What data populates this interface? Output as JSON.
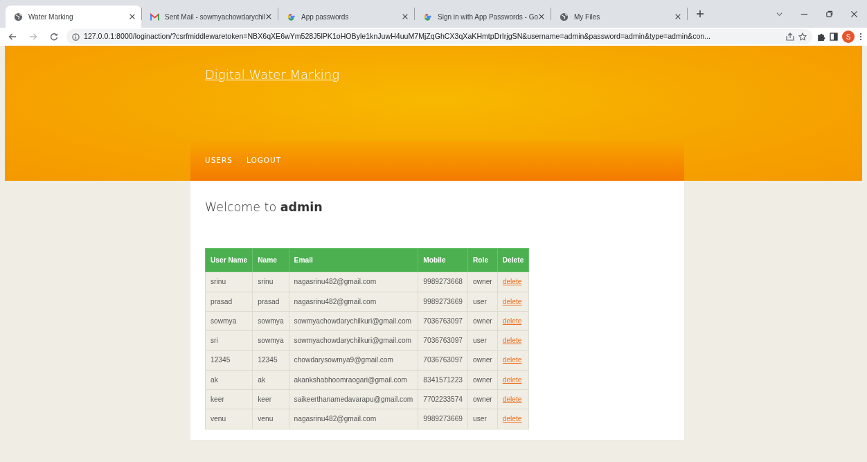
{
  "browser": {
    "tabs": [
      {
        "title": "Water Marking",
        "selected": true
      },
      {
        "title": "Sent Mail - sowmyachowdarychil",
        "selected": false
      },
      {
        "title": "App passwords",
        "selected": false
      },
      {
        "title": "Sign in with App Passwords - Go",
        "selected": false
      },
      {
        "title": "My Files",
        "selected": false
      }
    ],
    "address": "127.0.0.1:8000/loginaction/?csrfmiddlewaretoken=NBX6qXE6wYm528J5lPK1oHOByle1knJuwH4uuM7MjZqGhCX3qXaKHmtpDrIrjgSN&username=admin&password=admin&type=admin&con...",
    "profile": "S"
  },
  "site_title": "Digital Water Marking",
  "nav": [
    "USERS",
    "LOGOUT"
  ],
  "welcome": "Welcome to **admin**",
  "table": {
    "columns": [
      "User Name",
      "Name",
      "Email",
      "Mobile",
      "Role",
      "Delete"
    ],
    "rows": [
      [
        "srinu",
        "srinu",
        "nagasrinu482@gmail.com",
        "9989273668",
        "owner",
        "delete"
      ],
      [
        "prasad",
        "prasad",
        "nagasrinu482@gmail.com",
        "9989273669",
        "user",
        "delete"
      ],
      [
        "sowmya",
        "sowmya",
        "sowmyachowdarychilkuri@gmail.com",
        "7036763097",
        "owner",
        "delete"
      ],
      [
        "sri",
        "sowmya",
        "sowmyachowdarychilkuri@gmail.com",
        "7036763097",
        "user",
        "delete"
      ],
      [
        "12345",
        "12345",
        "chowdarysowmya9@gmail.com",
        "7036763097",
        "owner",
        "delete"
      ],
      [
        "ak",
        "ak",
        "akankshabhoomraogari@gmail.com",
        "8341571223",
        "owner",
        "delete"
      ],
      [
        "keer",
        "keer",
        "saikeerthanamedavarapu@gmail.com",
        "7702233574",
        "owner",
        "delete"
      ],
      [
        "venu",
        "venu",
        "nagasrinu482@gmail.com",
        "9989273669",
        "user",
        "delete"
      ]
    ]
  }
}
